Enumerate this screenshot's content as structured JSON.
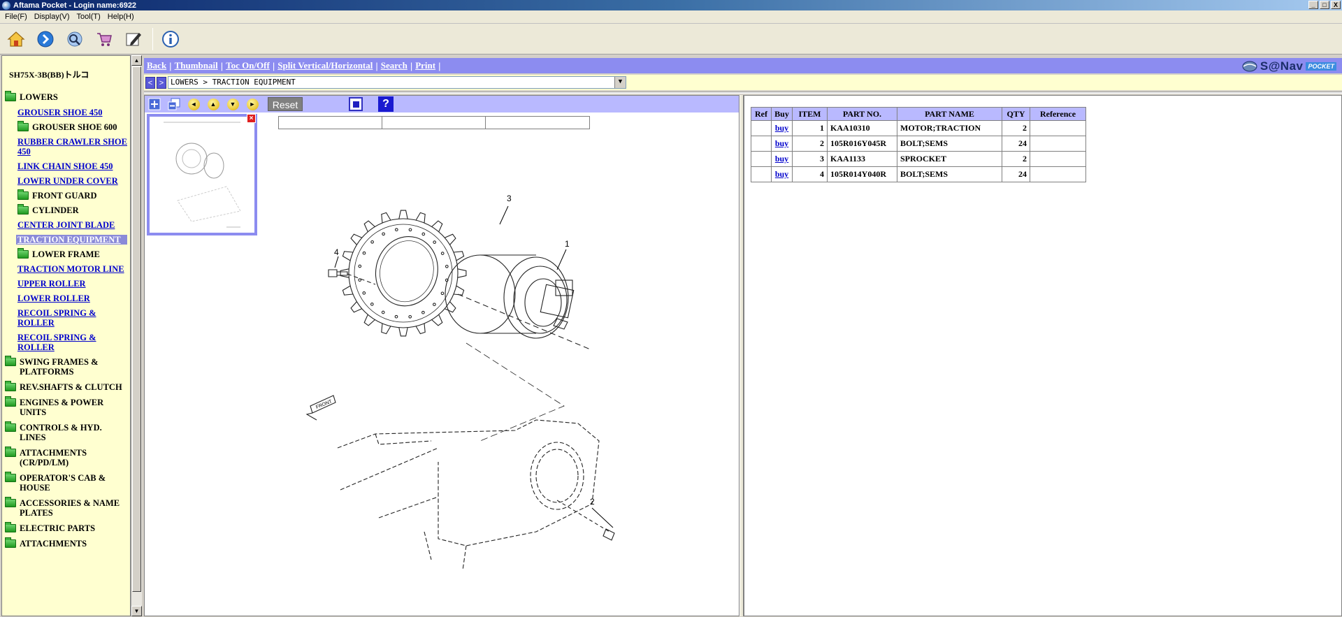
{
  "window": {
    "title": "Aftama Pocket - Login name:6922",
    "min": "_",
    "max": "□",
    "close": "X"
  },
  "menu": [
    "File(F)",
    "Display(V)",
    "Tool(T)",
    "Help(H)"
  ],
  "toolbar": {
    "icons": [
      "home-icon",
      "forward-icon",
      "search-globe-icon",
      "cart-icon",
      "edit-icon",
      "info-icon"
    ]
  },
  "sidebar": {
    "model": "SH75X-3B(BB)トルコ",
    "items": [
      {
        "label": "LOWERS",
        "type": "folder",
        "indent": 0
      },
      {
        "label": "GROUSER SHOE 450",
        "type": "link",
        "indent": 1
      },
      {
        "label": "GROUSER SHOE 600",
        "type": "folder",
        "indent": 1
      },
      {
        "label": "RUBBER CRAWLER SHOE 450",
        "type": "link",
        "indent": 1
      },
      {
        "label": "LINK CHAIN SHOE 450",
        "type": "link",
        "indent": 1
      },
      {
        "label": "LOWER UNDER COVER",
        "type": "link",
        "indent": 1
      },
      {
        "label": "FRONT GUARD",
        "type": "folder",
        "indent": 1
      },
      {
        "label": "CYLINDER",
        "type": "folder",
        "indent": 1
      },
      {
        "label": "CENTER JOINT BLADE",
        "type": "link",
        "indent": 1
      },
      {
        "label": "TRACTION EQUIPMENT",
        "type": "link",
        "indent": 1,
        "selected": true
      },
      {
        "label": "LOWER FRAME",
        "type": "folder",
        "indent": 1
      },
      {
        "label": "TRACTION MOTOR LINE",
        "type": "link",
        "indent": 1
      },
      {
        "label": "UPPER ROLLER",
        "type": "link",
        "indent": 1
      },
      {
        "label": "LOWER ROLLER",
        "type": "link",
        "indent": 1
      },
      {
        "label": "RECOIL SPRING & ROLLER",
        "type": "link",
        "indent": 1
      },
      {
        "label": "RECOIL SPRING & ROLLER",
        "type": "link",
        "indent": 1
      },
      {
        "label": "SWING FRAMES & PLATFORMS",
        "type": "folder",
        "indent": 0
      },
      {
        "label": "REV.SHAFTS & CLUTCH",
        "type": "folder",
        "indent": 0
      },
      {
        "label": "ENGINES & POWER UNITS",
        "type": "folder",
        "indent": 0
      },
      {
        "label": "CONTROLS & HYD. LINES",
        "type": "folder",
        "indent": 0
      },
      {
        "label": "ATTACHMENTS (CR/PD/LM)",
        "type": "folder",
        "indent": 0
      },
      {
        "label": "OPERATOR'S CAB & HOUSE",
        "type": "folder",
        "indent": 0
      },
      {
        "label": "ACCESSORIES & NAME PLATES",
        "type": "folder",
        "indent": 0
      },
      {
        "label": "ELECTRIC PARTS",
        "type": "folder",
        "indent": 0
      },
      {
        "label": "ATTACHMENTS",
        "type": "folder",
        "indent": 0
      }
    ]
  },
  "links": [
    "Back",
    "Thumbnail",
    "Toc On/Off",
    "Split Vertical/Horizontal",
    "Search",
    "Print"
  ],
  "brand": {
    "name": "S@Nav",
    "tag": "POCKET"
  },
  "breadcrumb": {
    "prev": "<",
    "next": ">",
    "value": "LOWERS > TRACTION EQUIPMENT",
    "dropdown": "▼"
  },
  "drawtools": {
    "reset": "Reset",
    "help": "?",
    "close": "×",
    "arrows": [
      "◄",
      "▲",
      "▼",
      "►"
    ]
  },
  "callouts": [
    "1",
    "2",
    "3",
    "4"
  ],
  "front_label": "FRONT",
  "parts": {
    "headers": [
      "Ref",
      "Buy",
      "ITEM",
      "PART NO.",
      "PART NAME",
      "QTY",
      "Reference"
    ],
    "rows": [
      {
        "ref": "",
        "buy": "buy",
        "item": "1",
        "part_no": "KAA10310",
        "name": "MOTOR;TRACTION",
        "qty": "2",
        "reference": ""
      },
      {
        "ref": "",
        "buy": "buy",
        "item": "2",
        "part_no": "105R016Y045R",
        "name": "BOLT;SEMS",
        "qty": "24",
        "reference": ""
      },
      {
        "ref": "",
        "buy": "buy",
        "item": "3",
        "part_no": "KAA1133",
        "name": "SPROCKET",
        "qty": "2",
        "reference": ""
      },
      {
        "ref": "",
        "buy": "buy",
        "item": "4",
        "part_no": "105R014Y040R",
        "name": "BOLT;SEMS",
        "qty": "24",
        "reference": ""
      }
    ]
  }
}
